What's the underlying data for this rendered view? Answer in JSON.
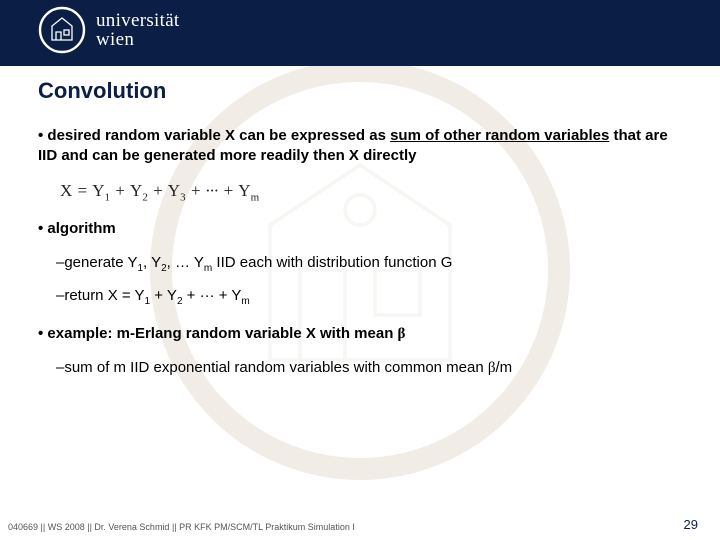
{
  "header": {
    "uni_line1": "universität",
    "uni_line2": "wien"
  },
  "title": "Convolution",
  "bullet1_prefix": "• desired random variable X can be expressed as ",
  "bullet1_underlined": "sum of other random variables",
  "bullet1_suffix": " that are IID and can be generated more readily then X directly",
  "formula": "X = Y₁ + Y₂ + Y₃ + ··· + Yₘ",
  "bullet2": "• algorithm",
  "sub2a_prefix": "–generate Y",
  "sub2a_mid1": ", Y",
  "sub2a_mid2": ", … Y",
  "sub2a_suffix": " IID each with distribution function G",
  "sub2b_prefix": "–return X = Y",
  "sub2b_mid1": " + Y",
  "sub2b_mid2": " + ··· + Y",
  "bullet3_prefix": "• example: m-Erlang random variable X with mean ",
  "bullet3_beta": "β",
  "sub3_prefix": "–sum of m IID exponential random variables with common mean  ",
  "sub3_suffix": "/m",
  "footer_left": "040669 || WS 2008 || Dr. Verena Schmid || PR KFK PM/SCM/TL Praktikum Simulation I",
  "page_number": "29",
  "idx": {
    "one": "1",
    "two": "2",
    "m": "m"
  }
}
